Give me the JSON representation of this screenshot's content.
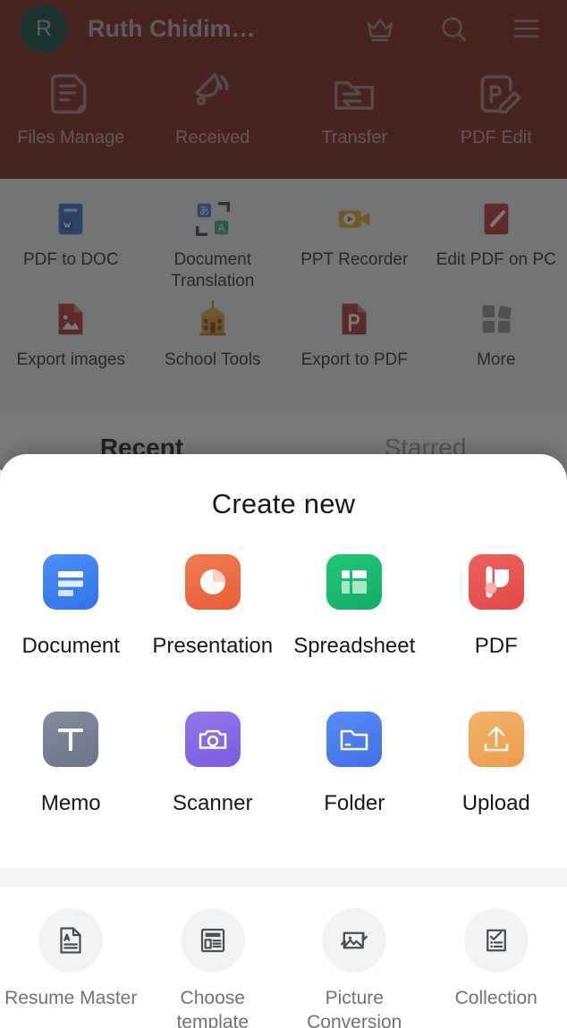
{
  "header": {
    "avatar_initial": "R",
    "user_name": "Ruth Chidim…",
    "brand_color": "#7b1f12",
    "avatar_color": "#0d463f",
    "actions": [
      {
        "name": "crown-icon",
        "label": "Premium"
      },
      {
        "name": "search-icon",
        "label": "Search"
      },
      {
        "name": "menu-icon",
        "label": "Menu"
      }
    ],
    "quick_actions": [
      {
        "icon": "files-manage-icon",
        "label": "Files Manage"
      },
      {
        "icon": "received-icon",
        "label": "Received"
      },
      {
        "icon": "transfer-icon",
        "label": "Transfer"
      },
      {
        "icon": "pdf-edit-icon",
        "label": "PDF Edit"
      }
    ]
  },
  "tools": [
    {
      "icon": "pdf-to-doc-icon",
      "label": "PDF to DOC",
      "color": "#2f6fd0"
    },
    {
      "icon": "document-translation-icon",
      "label": "Document Translation",
      "color": "#3a7bd5"
    },
    {
      "icon": "ppt-recorder-icon",
      "label": "PPT Recorder",
      "color": "#e8a81c"
    },
    {
      "icon": "edit-pdf-on-pc-icon",
      "label": "Edit PDF on PC",
      "color": "#b8312a"
    },
    {
      "icon": "export-images-icon",
      "label": "Export images",
      "color": "#b8312a"
    },
    {
      "icon": "school-tools-icon",
      "label": "School Tools",
      "color": "#d79a2b"
    },
    {
      "icon": "export-to-pdf-icon",
      "label": "Export to PDF",
      "color": "#b8312a"
    },
    {
      "icon": "more-icon",
      "label": "More",
      "color": "#8d9196"
    }
  ],
  "tabs": [
    {
      "label": "Recent",
      "active": true
    },
    {
      "label": "Starred",
      "active": false
    }
  ],
  "sheet": {
    "title": "Create new",
    "create_items": [
      {
        "icon": "document-icon",
        "label": "Document",
        "color": "#3f86f5"
      },
      {
        "icon": "presentation-icon",
        "label": "Presentation",
        "color": "#ed6a43"
      },
      {
        "icon": "spreadsheet-icon",
        "label": "Spreadsheet",
        "color": "#1ab96f"
      },
      {
        "icon": "pdf-icon",
        "label": "PDF",
        "color": "#e8524f"
      },
      {
        "icon": "memo-icon",
        "label": "Memo",
        "color": "#767f93"
      },
      {
        "icon": "scanner-icon",
        "label": "Scanner",
        "color": "#8566e8"
      },
      {
        "icon": "folder-icon",
        "label": "Folder",
        "color": "#4a7ef0"
      },
      {
        "icon": "upload-icon",
        "label": "Upload",
        "color": "#f0a85a"
      }
    ],
    "extra_items": [
      {
        "icon": "resume-master-icon",
        "label": "Resume Master"
      },
      {
        "icon": "choose-template-icon",
        "label": "Choose template"
      },
      {
        "icon": "picture-conversion-icon",
        "label": "Picture Conversion"
      },
      {
        "icon": "collection-icon",
        "label": "Collection"
      }
    ]
  }
}
